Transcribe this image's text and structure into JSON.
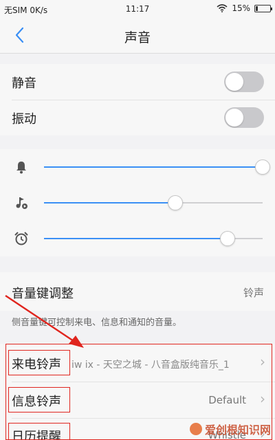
{
  "status": {
    "carrier": "无SIM 0K/s",
    "time": "11:17",
    "battery_text": "15%",
    "battery_level": 0.15
  },
  "nav": {
    "title": "声音",
    "back_icon": "chevron-left-icon"
  },
  "toggles": {
    "mute_label": "静音",
    "mute_on": false,
    "vibrate_label": "振动",
    "vibrate_on": false
  },
  "volumes": [
    {
      "icon": "bell-icon",
      "level": 1.0
    },
    {
      "icon": "music-icon",
      "level": 0.6
    },
    {
      "icon": "alarm-clock-icon",
      "level": 0.84
    }
  ],
  "volume_keys": {
    "label": "音量键调整",
    "value": "铃声",
    "caption": "侧音量键可控制来电、信息和通知的音量。"
  },
  "ringtones": {
    "incoming_label": "来电铃声",
    "incoming_value": "iw ix - 天空之城 - 八音盒版纯音乐_1",
    "message_label": "信息铃声",
    "message_value": "Default",
    "calendar_label": "日历提醒",
    "calendar_value": "Whistle"
  },
  "watermark": "爱创根知识网",
  "colors": {
    "accent": "#3a8ff5",
    "annotation": "#e0251e"
  }
}
